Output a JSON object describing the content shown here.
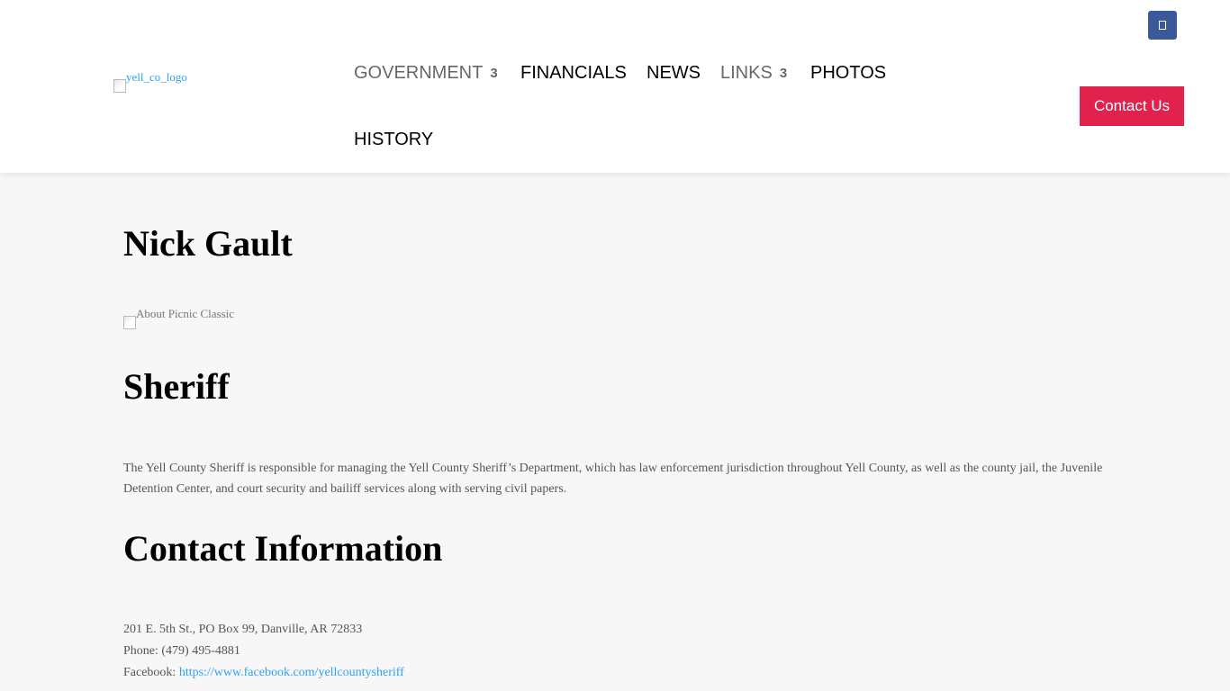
{
  "header": {
    "logo_alt": "yell_co_logo",
    "nav": [
      {
        "label": "GOVERNMENT",
        "arrow": "3"
      },
      {
        "label": "FINANCIALS"
      },
      {
        "label": "NEWS"
      },
      {
        "label": "LINKS",
        "arrow": "3"
      },
      {
        "label": "PHOTOS"
      },
      {
        "label": "HISTORY"
      }
    ],
    "contact_button": "Contact Us",
    "facebook_icon": "facebook-icon"
  },
  "main": {
    "name": "Nick Gault",
    "photo_alt": "About Picnic Classic",
    "role": "Sheriff",
    "description": "The Yell County Sheriff is responsible for managing the Yell County Sheriff’s Department, which has law enforcement jurisdiction throughout Yell County, as well as the county jail, the Juvenile Detention Center, and court security and bailiff services along with serving civil papers.",
    "contact_heading": "Contact Information",
    "address": "201 E. 5th St., PO Box 99, Danville, AR 72833",
    "phone": "Phone: (479) 495-4881",
    "facebook_label": "Facebook:",
    "facebook_url": "https://www.facebook.com/yellcountysheriff"
  },
  "colors": {
    "contact_button": "#e0224c",
    "facebook_button": "#3b5998",
    "link": "#2ea3f2",
    "background": "#f7f7f7"
  }
}
